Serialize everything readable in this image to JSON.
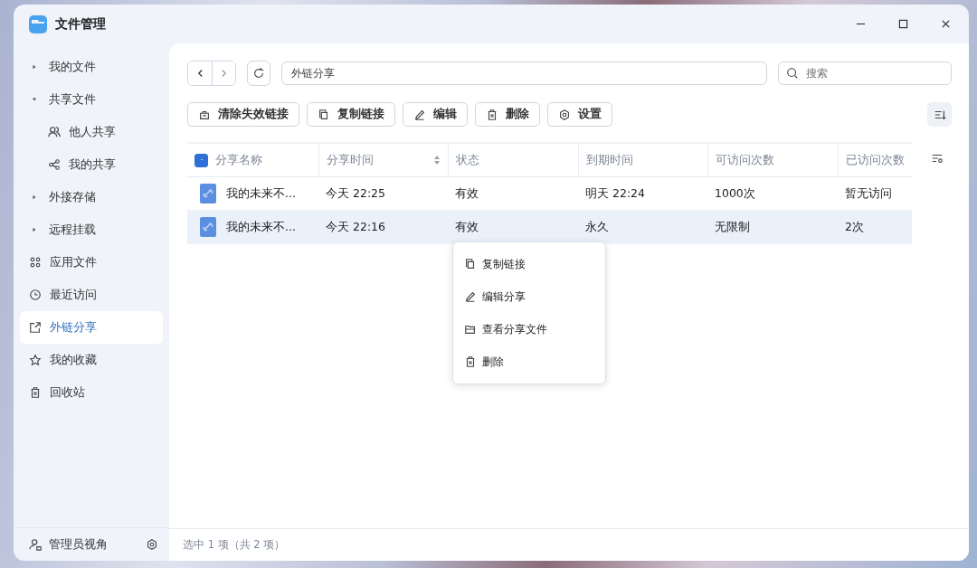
{
  "window": {
    "title": "文件管理"
  },
  "sidebar": {
    "items": [
      {
        "kind": "group",
        "label": "我的文件",
        "expanded": false,
        "selected": false
      },
      {
        "kind": "group",
        "label": "共享文件",
        "expanded": true,
        "selected": false,
        "children": [
          {
            "kind": "item",
            "label": "他人共享",
            "selected": false
          },
          {
            "kind": "item",
            "label": "我的共享",
            "selected": false
          }
        ]
      },
      {
        "kind": "group",
        "label": "外接存储",
        "expanded": false,
        "selected": false
      },
      {
        "kind": "group",
        "label": "远程挂载",
        "expanded": false,
        "selected": false
      },
      {
        "kind": "item",
        "label": "应用文件",
        "selected": false
      },
      {
        "kind": "item",
        "label": "最近访问",
        "selected": false
      },
      {
        "kind": "item",
        "label": "外链分享",
        "selected": true
      },
      {
        "kind": "item",
        "label": "我的收藏",
        "selected": false
      },
      {
        "kind": "item",
        "label": "回收站",
        "selected": false
      }
    ],
    "footer": {
      "label": "管理员视角"
    }
  },
  "path": {
    "value": "外链分享"
  },
  "search": {
    "placeholder": "搜索"
  },
  "toolbar": [
    "清除失效链接",
    "复制链接",
    "编辑",
    "删除",
    "设置"
  ],
  "table": {
    "select_all": {
      "checked": false,
      "indeterminate": true
    },
    "columns": [
      {
        "label": "分享名称",
        "sortable": false
      },
      {
        "label": "分享时间",
        "sortable": true
      },
      {
        "label": "状态",
        "sortable": false
      },
      {
        "label": "到期时间",
        "sortable": false
      },
      {
        "label": "可访问次数",
        "sortable": false
      },
      {
        "label": "已访问次数",
        "sortable": false
      }
    ],
    "rows": [
      {
        "selected": false,
        "cells": [
          "我的未来不...",
          "今天 22:25",
          "有效",
          "明天 22:24",
          "1000次",
          "暂无访问"
        ]
      },
      {
        "selected": true,
        "cells": [
          "我的未来不...",
          "今天 22:16",
          "有效",
          "永久",
          "无限制",
          "2次"
        ]
      }
    ]
  },
  "context_menu": {
    "items": [
      "复制链接",
      "编辑分享",
      "查看分享文件",
      "删除"
    ]
  },
  "status_bar": "选中 1 项（共 2 项）"
}
